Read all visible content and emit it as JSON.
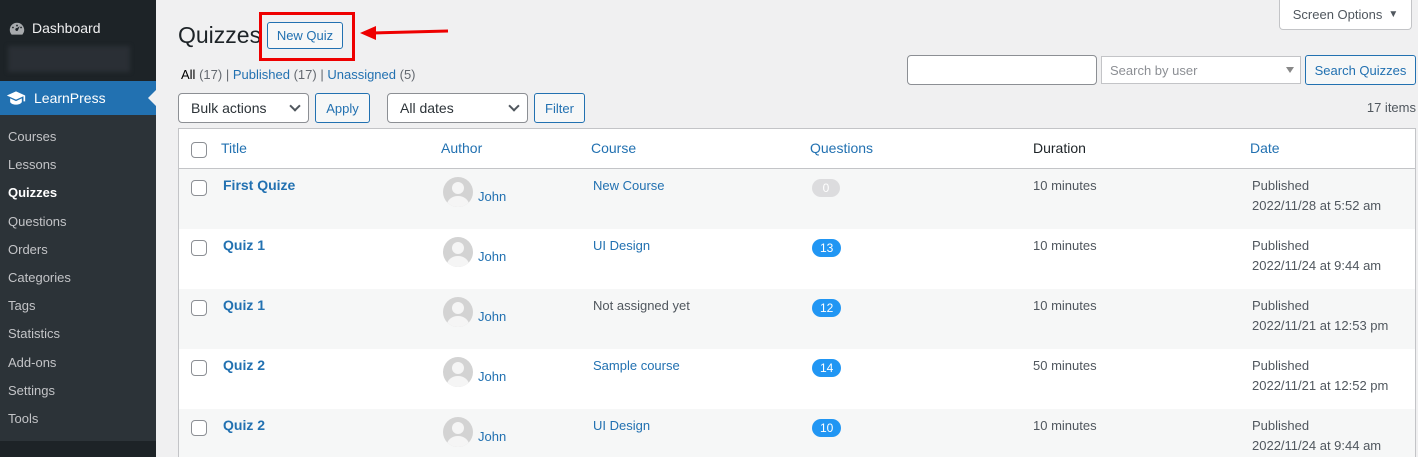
{
  "sidebar": {
    "dashboard_label": "Dashboard",
    "plugin_label": "LearnPress",
    "submenu": [
      {
        "label": "Courses"
      },
      {
        "label": "Lessons"
      },
      {
        "label": "Quizzes",
        "current": true
      },
      {
        "label": "Questions"
      },
      {
        "label": "Orders"
      },
      {
        "label": "Categories"
      },
      {
        "label": "Tags"
      },
      {
        "label": "Statistics"
      },
      {
        "label": "Add-ons"
      },
      {
        "label": "Settings"
      },
      {
        "label": "Tools"
      }
    ]
  },
  "header": {
    "screen_options": "Screen Options",
    "title": "Quizzes",
    "new_button": "New Quiz"
  },
  "filters": {
    "all": "All",
    "all_count": "(17)",
    "published": "Published",
    "published_count": "(17)",
    "unassigned": "Unassigned",
    "unassigned_count": "(5)",
    "separator": "|"
  },
  "search": {
    "input_value": "",
    "user_placeholder": "Search by user",
    "button": "Search Quizzes"
  },
  "tablenav": {
    "bulk_actions": "Bulk actions",
    "apply": "Apply",
    "dates": "All dates",
    "filter": "Filter",
    "items_count": "17 items"
  },
  "table": {
    "columns": {
      "title": "Title",
      "author": "Author",
      "course": "Course",
      "questions": "Questions",
      "duration": "Duration",
      "date": "Date"
    },
    "rows": [
      {
        "title": "First Quize",
        "author": "John",
        "course": "New Course",
        "course_assigned": true,
        "questions": "0",
        "duration": "10 minutes",
        "status": "Published",
        "date": "2022/11/28 at 5:52 am"
      },
      {
        "title": "Quiz 1",
        "author": "John",
        "course": "UI Design",
        "course_assigned": true,
        "questions": "13",
        "duration": "10 minutes",
        "status": "Published",
        "date": "2022/11/24 at 9:44 am"
      },
      {
        "title": "Quiz 1",
        "author": "John",
        "course": "Not assigned yet",
        "course_assigned": false,
        "questions": "12",
        "duration": "10 minutes",
        "status": "Published",
        "date": "2022/11/21 at 12:53 pm"
      },
      {
        "title": "Quiz 2",
        "author": "John",
        "course": "Sample course",
        "course_assigned": true,
        "questions": "14",
        "duration": "50 minutes",
        "status": "Published",
        "date": "2022/11/21 at 12:52 pm"
      },
      {
        "title": "Quiz 2",
        "author": "John",
        "course": "UI Design",
        "course_assigned": true,
        "questions": "10",
        "duration": "10 minutes",
        "status": "Published",
        "date": "2022/11/24 at 9:44 am"
      }
    ]
  },
  "colors": {
    "accent": "#2271b1",
    "sidebar_bg": "#1d2327",
    "highlight_red": "#e00000",
    "badge_blue": "#2196f3"
  }
}
